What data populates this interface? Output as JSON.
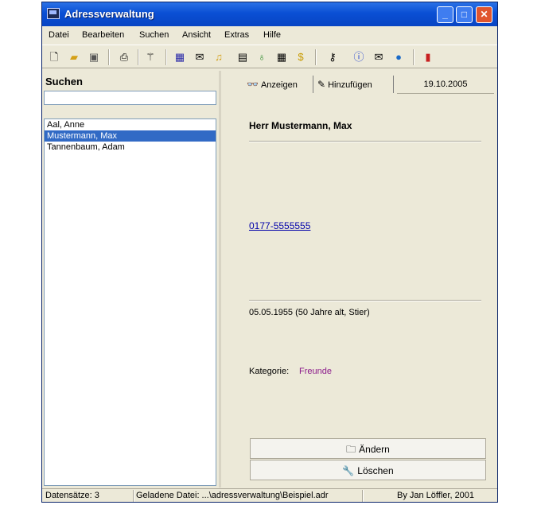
{
  "window": {
    "title": "Adressverwaltung"
  },
  "menu": [
    "Datei",
    "Bearbeiten",
    "Suchen",
    "Ansicht",
    "Extras",
    "Hilfe"
  ],
  "toolbar": {
    "icons": [
      "new-file-icon",
      "open-folder-icon",
      "save-icon",
      "print-icon",
      "wand-icon",
      "calendar-icon",
      "mail-icon",
      "bell-icon",
      "notepad-icon",
      "lightbulb-icon",
      "grid-icon",
      "money-icon",
      "key-icon",
      "info-icon",
      "mail-icon",
      "globe-icon",
      "exit-icon"
    ]
  },
  "search": {
    "label": "Suchen",
    "value": ""
  },
  "contacts": [
    "Aal, Anne",
    "Mustermann, Max",
    "Tannenbaum, Adam"
  ],
  "tabs": {
    "anzeigen": "Anzeigen",
    "hinzufuegen": "Hinzufügen",
    "date": "19.10.2005"
  },
  "detail": {
    "name": "Herr Mustermann, Max",
    "phone": "0177-5555555",
    "birth": "05.05.1955   (50 Jahre alt, Stier)",
    "category_label": "Kategorie:",
    "category_value": "Freunde"
  },
  "buttons": {
    "edit": "Ändern",
    "delete": "Löschen"
  },
  "status": {
    "records": "Datensätze: 3",
    "file": "Geladene Datei: ...\\adressverwaltung\\Beispiel.adr",
    "author": "By Jan Löffler, 2001"
  }
}
